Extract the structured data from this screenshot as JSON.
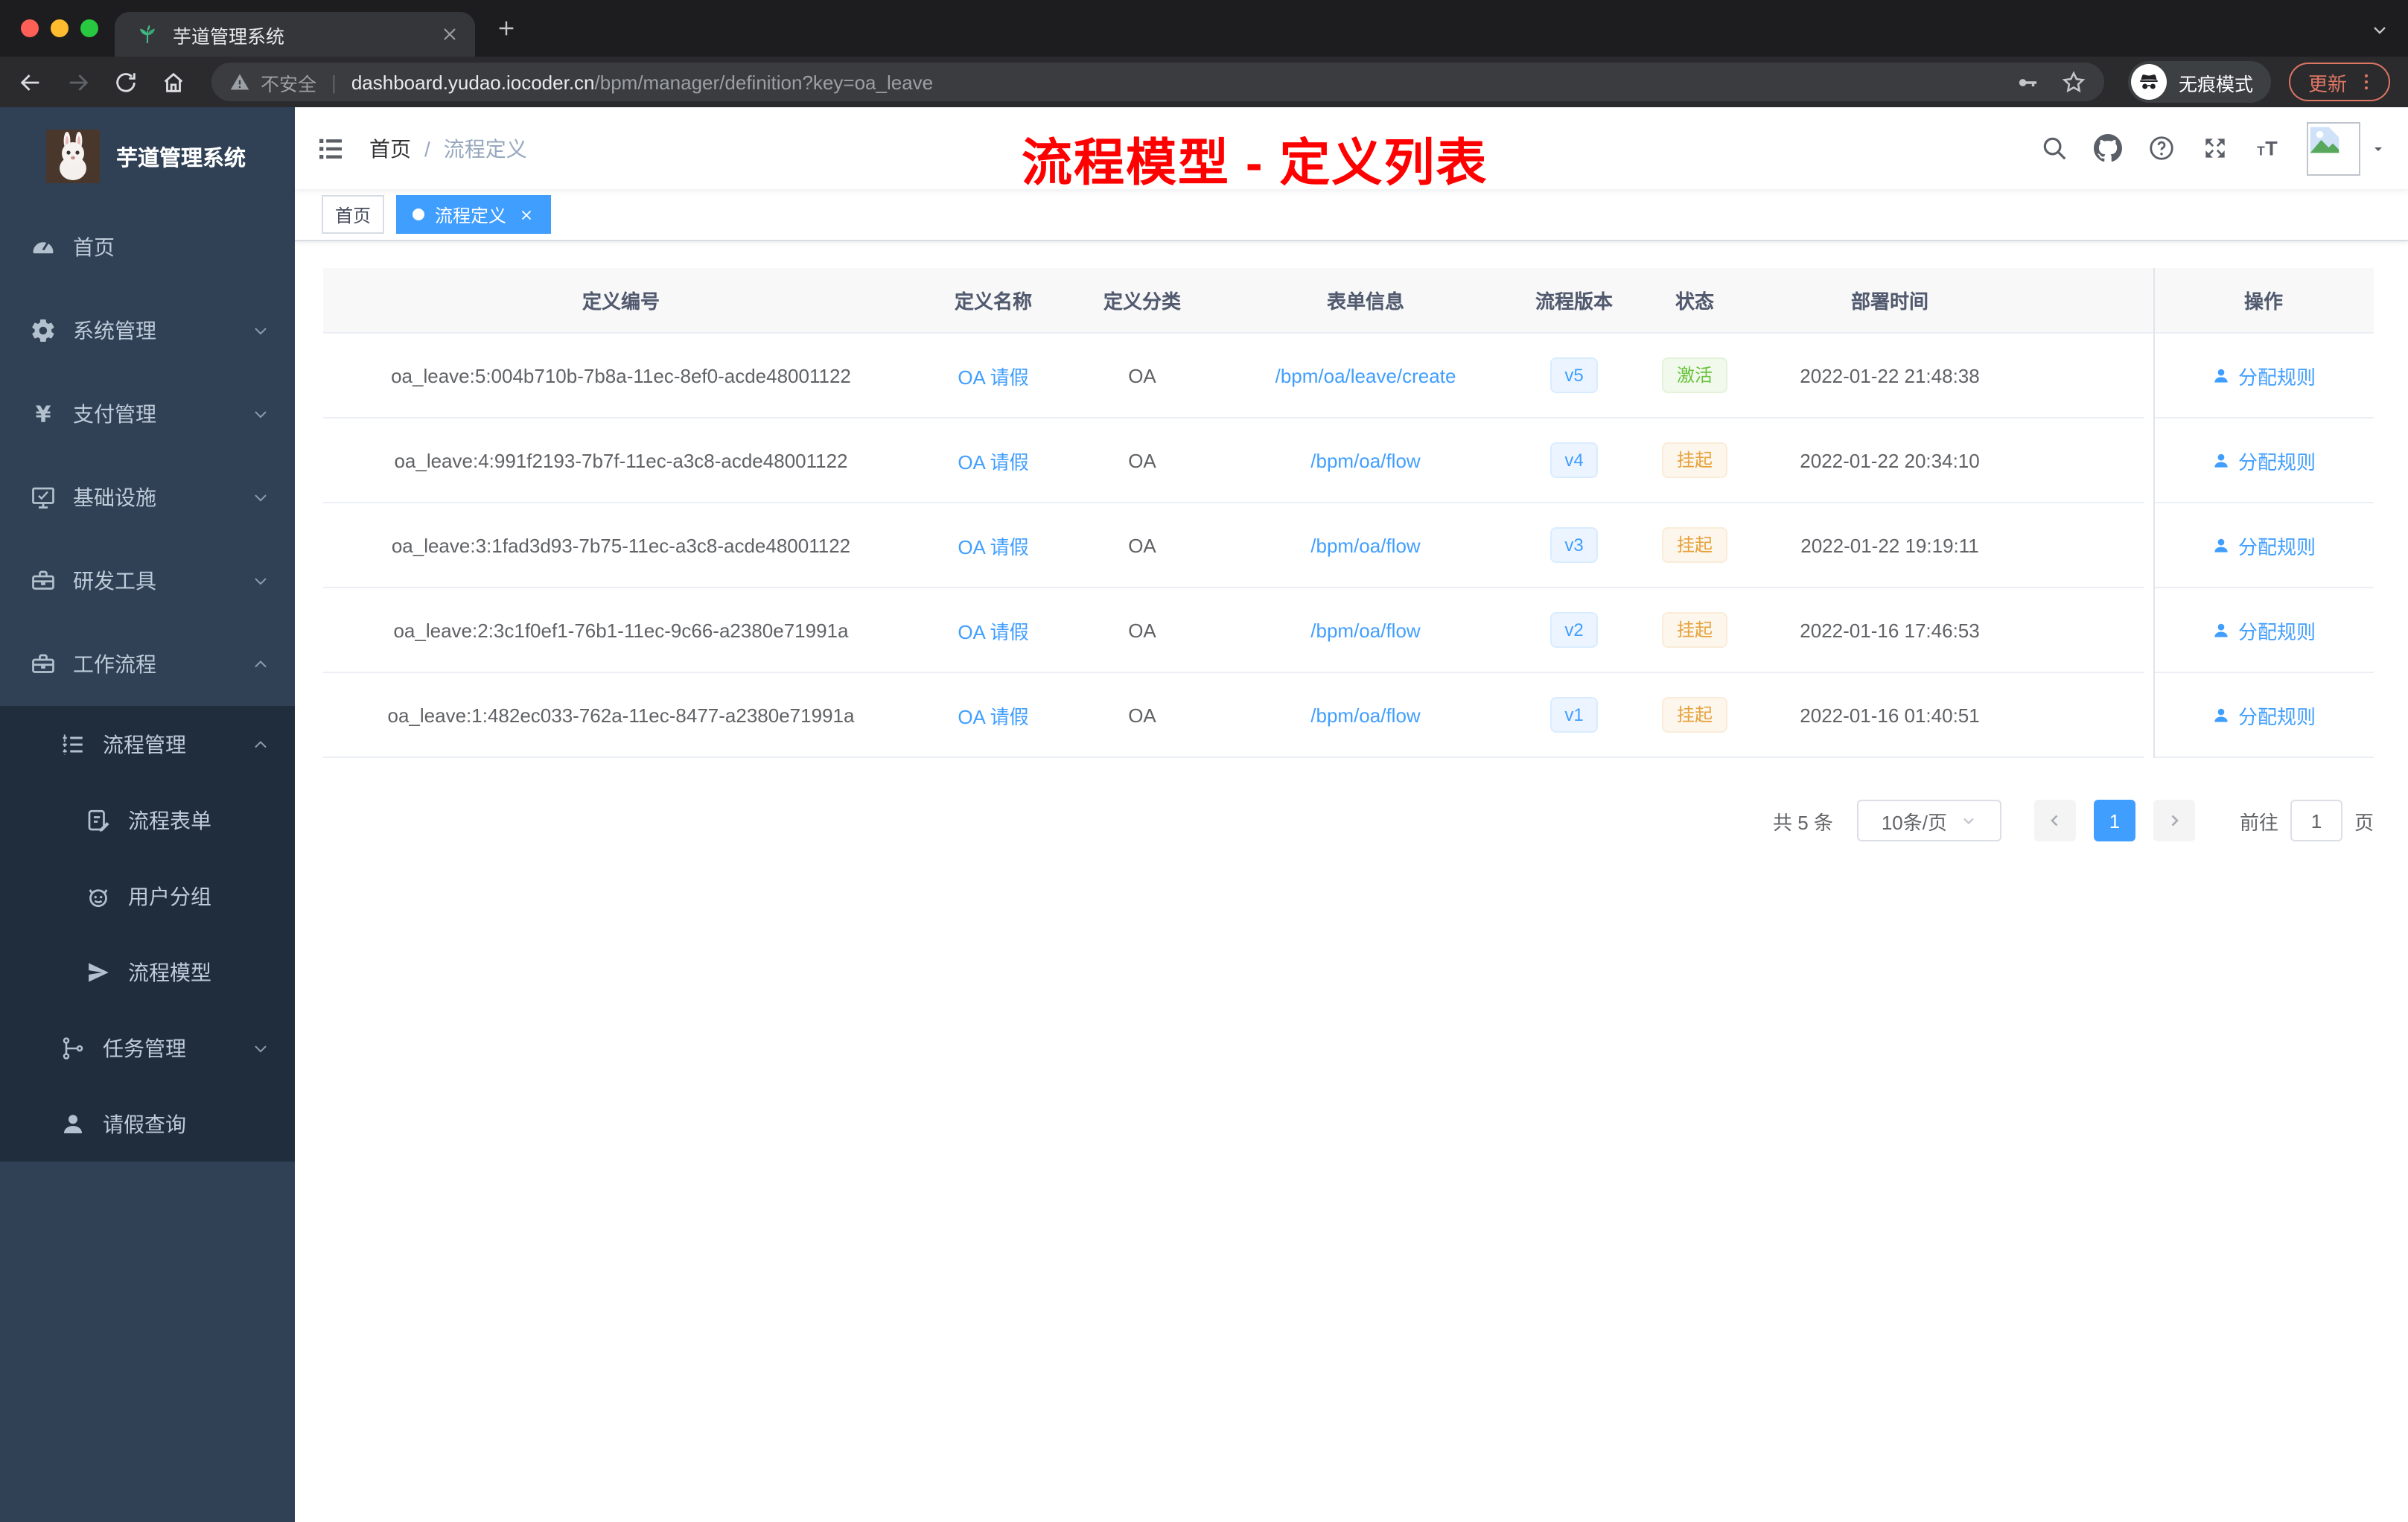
{
  "browser": {
    "tab_title": "芋道管理系统",
    "not_secure": "不安全",
    "url_host": "dashboard.yudao.iocoder.cn",
    "url_path": "/bpm/manager/definition?key=oa_leave",
    "incognito_label": "无痕模式",
    "update_label": "更新"
  },
  "sidebar": {
    "title": "芋道管理系统",
    "items": [
      {
        "key": "home",
        "icon": "dashboard-icon",
        "label": "首页",
        "level": 1,
        "chevron": null,
        "dark": false
      },
      {
        "key": "system",
        "icon": "gear-icon",
        "label": "系统管理",
        "level": 1,
        "chevron": "down",
        "dark": false
      },
      {
        "key": "payment",
        "icon": "yen-icon",
        "label": "支付管理",
        "level": 1,
        "chevron": "down",
        "dark": false
      },
      {
        "key": "infra",
        "icon": "monitor-icon",
        "label": "基础设施",
        "level": 1,
        "chevron": "down",
        "dark": false
      },
      {
        "key": "devtools",
        "icon": "toolbox-icon",
        "label": "研发工具",
        "level": 1,
        "chevron": "down",
        "dark": false
      },
      {
        "key": "workflow",
        "icon": "toolbox-icon",
        "label": "工作流程",
        "level": 1,
        "chevron": "up",
        "dark": false
      },
      {
        "key": "process-mgmt",
        "icon": "tree-list-icon",
        "label": "流程管理",
        "level": 2,
        "chevron": "up",
        "dark": true
      },
      {
        "key": "process-form",
        "icon": "form-icon",
        "label": "流程表单",
        "level": 3,
        "chevron": null,
        "dark": true
      },
      {
        "key": "user-group",
        "icon": "robot-icon",
        "label": "用户分组",
        "level": 3,
        "chevron": null,
        "dark": true
      },
      {
        "key": "process-model",
        "icon": "send-icon",
        "label": "流程模型",
        "level": 3,
        "chevron": null,
        "dark": true
      },
      {
        "key": "task-mgmt",
        "icon": "org-tree-icon",
        "label": "任务管理",
        "level": 2,
        "chevron": "down",
        "dark": true
      },
      {
        "key": "leave-query",
        "icon": "user-icon",
        "label": "请假查询",
        "level": 2,
        "chevron": null,
        "dark": true
      }
    ]
  },
  "header": {
    "breadcrumb": [
      "首页",
      "流程定义"
    ],
    "annotation": "流程模型 - 定义列表",
    "actions": [
      "search",
      "github",
      "help",
      "fullscreen",
      "font-size",
      "avatar",
      "caret-down"
    ]
  },
  "tags": [
    {
      "label": "首页",
      "active": false,
      "closable": false
    },
    {
      "label": "流程定义",
      "active": true,
      "closable": true
    }
  ],
  "table": {
    "columns": [
      "定义编号",
      "定义名称",
      "定义分类",
      "表单信息",
      "流程版本",
      "状态",
      "部署时间",
      "操作"
    ],
    "rows": [
      {
        "id": "oa_leave:5:004b710b-7b8a-11ec-8ef0-acde48001122",
        "name": "OA 请假",
        "category": "OA",
        "form": "/bpm/oa/leave/create",
        "version": "v5",
        "status": "激活",
        "status_type": "success",
        "deployed_at": "2022-01-22 21:48:38",
        "action": "分配规则"
      },
      {
        "id": "oa_leave:4:991f2193-7b7f-11ec-a3c8-acde48001122",
        "name": "OA 请假",
        "category": "OA",
        "form": "/bpm/oa/flow",
        "version": "v4",
        "status": "挂起",
        "status_type": "warning",
        "deployed_at": "2022-01-22 20:34:10",
        "action": "分配规则"
      },
      {
        "id": "oa_leave:3:1fad3d93-7b75-11ec-a3c8-acde48001122",
        "name": "OA 请假",
        "category": "OA",
        "form": "/bpm/oa/flow",
        "version": "v3",
        "status": "挂起",
        "status_type": "warning",
        "deployed_at": "2022-01-22 19:19:11",
        "action": "分配规则"
      },
      {
        "id": "oa_leave:2:3c1f0ef1-76b1-11ec-9c66-a2380e71991a",
        "name": "OA 请假",
        "category": "OA",
        "form": "/bpm/oa/flow",
        "version": "v2",
        "status": "挂起",
        "status_type": "warning",
        "deployed_at": "2022-01-16 17:46:53",
        "action": "分配规则"
      },
      {
        "id": "oa_leave:1:482ec033-762a-11ec-8477-a2380e71991a",
        "name": "OA 请假",
        "category": "OA",
        "form": "/bpm/oa/flow",
        "version": "v1",
        "status": "挂起",
        "status_type": "warning",
        "deployed_at": "2022-01-16 01:40:51",
        "action": "分配规则"
      }
    ]
  },
  "pagination": {
    "total": "共 5 条",
    "page_size": "10条/页",
    "current_page": "1",
    "goto_label": "前往",
    "goto_value": "1",
    "unit": "页"
  },
  "colors": {
    "primary": "#409eff",
    "success_text": "#67c23a",
    "warning_text": "#e6a23c",
    "annotation_red": "#ff0000",
    "sidebar_bg": "#304156",
    "submenu_bg": "#1f2d3d",
    "active_tag_bg": "#409eff"
  }
}
